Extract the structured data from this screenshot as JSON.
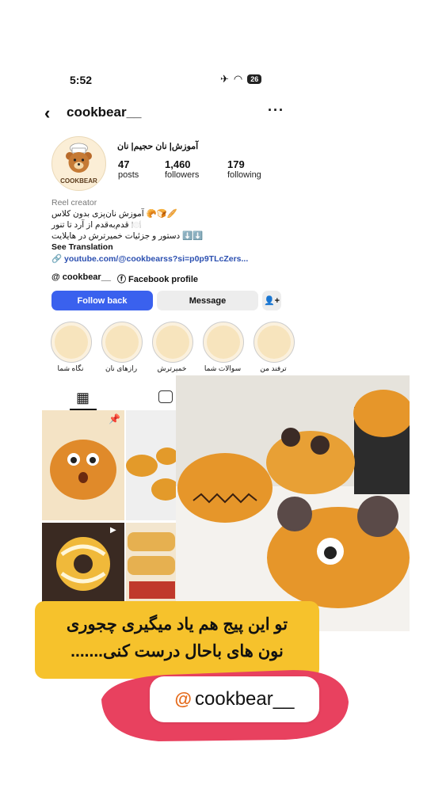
{
  "status_bar": {
    "time": "5:52",
    "battery": "26"
  },
  "header": {
    "username": "cookbear__"
  },
  "profile": {
    "avatar_text": "COOKBEAR",
    "name": "آموزش| نان حجیم| نان",
    "stats": [
      {
        "num": "47",
        "label": "posts"
      },
      {
        "num": "1,460",
        "label": "followers"
      },
      {
        "num": "179",
        "label": "following"
      }
    ],
    "category": "Reel creator",
    "bio_lines": [
      "🥖🍞🥐 آموزش نان‌پزی بدون کلاس",
      "🍽️ قدم‌به‌قدم از آرد تا تنور",
      "⬇️⬇️ دستور و جزئیات خمیرترش در هایلایت"
    ],
    "see_translation": "See Translation",
    "link": "youtube.com/@cookbearss?si=p0p9TLcZers...",
    "threads_label": "cookbear__",
    "facebook_label": "Facebook profile"
  },
  "buttons": {
    "follow": "Follow back",
    "message": "Message"
  },
  "highlights": [
    {
      "label": "ترفند من"
    },
    {
      "label": "سوالات شما"
    },
    {
      "label": "خمیرترش"
    },
    {
      "label": "رازهای نان"
    },
    {
      "label": "نگاه شما"
    }
  ],
  "overlay": {
    "caption_line1": "تو این پیج هم یاد میگیری چجوری",
    "caption_line2": "نون های باحال درست کنی.......",
    "handle": "cookbear__"
  },
  "colors": {
    "accent": "#3a61ee",
    "caption_bg": "#f6c22c",
    "highlight_pink": "#e8415f"
  }
}
